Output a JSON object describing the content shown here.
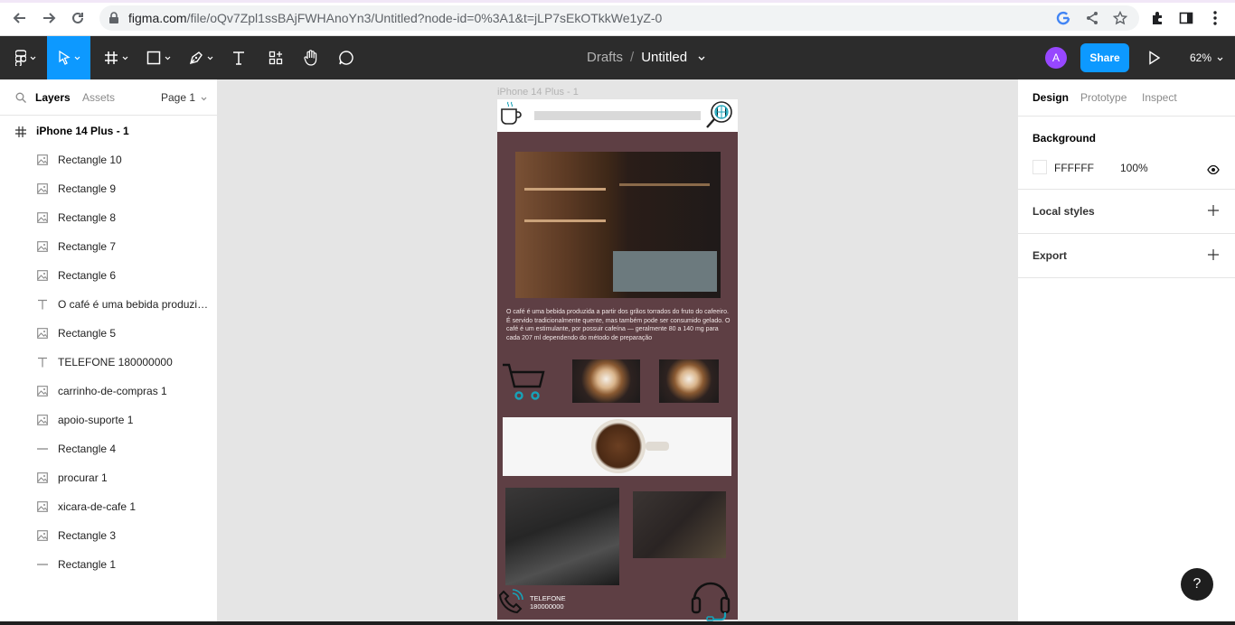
{
  "browser": {
    "url_host": "figma.com",
    "url_path": "/file/oQv7Zpl1ssBAjFWHAnoYn3/Untitled?node-id=0%3A1&t=jLP7sEkOTkkWe1yZ-0"
  },
  "toolbar": {
    "breadcrumb_parent": "Drafts",
    "breadcrumb_separator": "/",
    "file_name": "Untitled",
    "avatar_initial": "A",
    "share_label": "Share",
    "zoom": "62%",
    "active_tool": "move"
  },
  "left_panel": {
    "tabs": [
      "Layers",
      "Assets"
    ],
    "active_tab": "Layers",
    "page_selector": "Page 1",
    "root_layer": "iPhone 14 Plus - 1",
    "layers": [
      {
        "label": "Rectangle 10",
        "icon": "image"
      },
      {
        "label": "Rectangle 9",
        "icon": "image"
      },
      {
        "label": "Rectangle 8",
        "icon": "image"
      },
      {
        "label": "Rectangle 7",
        "icon": "image"
      },
      {
        "label": "Rectangle 6",
        "icon": "image"
      },
      {
        "label": "O café é uma bebida produzid...",
        "icon": "text"
      },
      {
        "label": "Rectangle 5",
        "icon": "image"
      },
      {
        "label": "TELEFONE 180000000",
        "icon": "text"
      },
      {
        "label": "carrinho-de-compras 1",
        "icon": "image"
      },
      {
        "label": "apoio-suporte 1",
        "icon": "image"
      },
      {
        "label": "Rectangle 4",
        "icon": "line"
      },
      {
        "label": "procurar 1",
        "icon": "image"
      },
      {
        "label": "xicara-de-cafe 1",
        "icon": "image"
      },
      {
        "label": "Rectangle 3",
        "icon": "image"
      },
      {
        "label": "Rectangle 1",
        "icon": "line"
      }
    ]
  },
  "canvas": {
    "frame_label": "iPhone 14 Plus - 1",
    "body_text": "O café é uma bebida produzida a partir dos grãos torrados do fruto do cafeeiro. É servido tradicionalmente quente, mas também pode ser consumido gelado. O café é um estimulante, por possuir cafeína — geralmente 80 a 140 mg para cada 207 ml dependendo do método de preparação",
    "phone_label": "TELEFONE",
    "phone_number": "180000000",
    "frame_bg_color": "#5e3f44"
  },
  "right_panel": {
    "tabs": [
      "Design",
      "Prototype",
      "Inspect"
    ],
    "active_tab": "Design",
    "background_title": "Background",
    "background_hex": "FFFFFF",
    "background_opacity": "100%",
    "local_styles_title": "Local styles",
    "export_title": "Export",
    "help_label": "?"
  }
}
